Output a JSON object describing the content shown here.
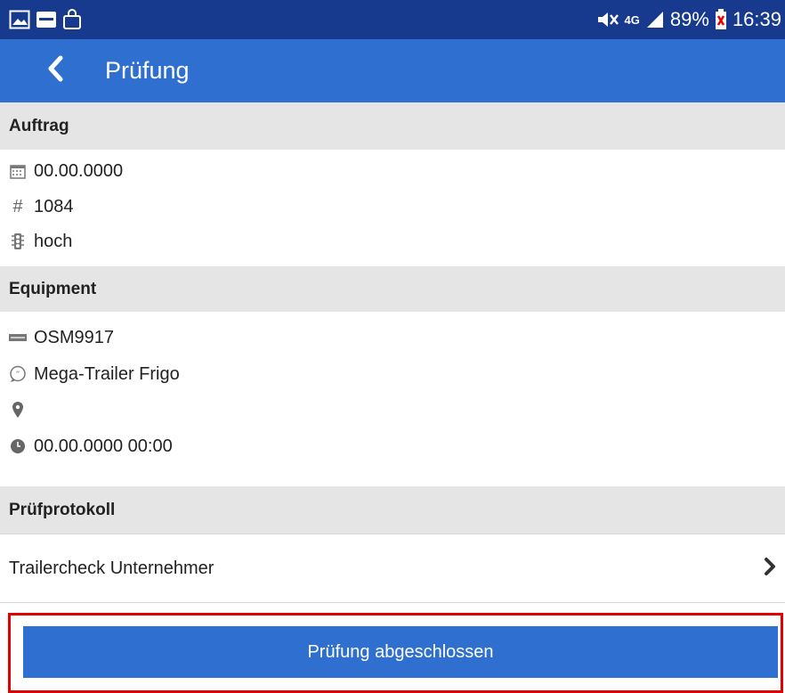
{
  "status_bar": {
    "left_icons": [
      "image-icon",
      "notification-icon",
      "shopping-bag-icon"
    ],
    "right_icons": [
      "mute-icon",
      "4g-icon",
      "signal-icon"
    ],
    "network_label": "4G",
    "battery": "89%",
    "time": "16:39"
  },
  "app_bar": {
    "title": "Prüfung",
    "back_icon": "chevron-left-icon"
  },
  "sections": {
    "auftrag": {
      "heading": "Auftrag",
      "date": "00.00.0000",
      "number": "1084",
      "priority": "hoch"
    },
    "equipment": {
      "heading": "Equipment",
      "plate": "OSM9917",
      "description": "Mega-Trailer Frigo",
      "location": "",
      "timestamp": "00.00.0000 00:00"
    },
    "pruefprotokoll": {
      "heading": "Prüfprotokoll",
      "items": [
        {
          "label": "Trailercheck Unternehmer"
        }
      ]
    }
  },
  "primary_action": {
    "label": "Prüfung abgeschlossen"
  },
  "colors": {
    "status_bar": "#173a8e",
    "app_bar": "#2f6fd0",
    "section_header": "#e5e5e5",
    "highlight": "#e30000"
  }
}
